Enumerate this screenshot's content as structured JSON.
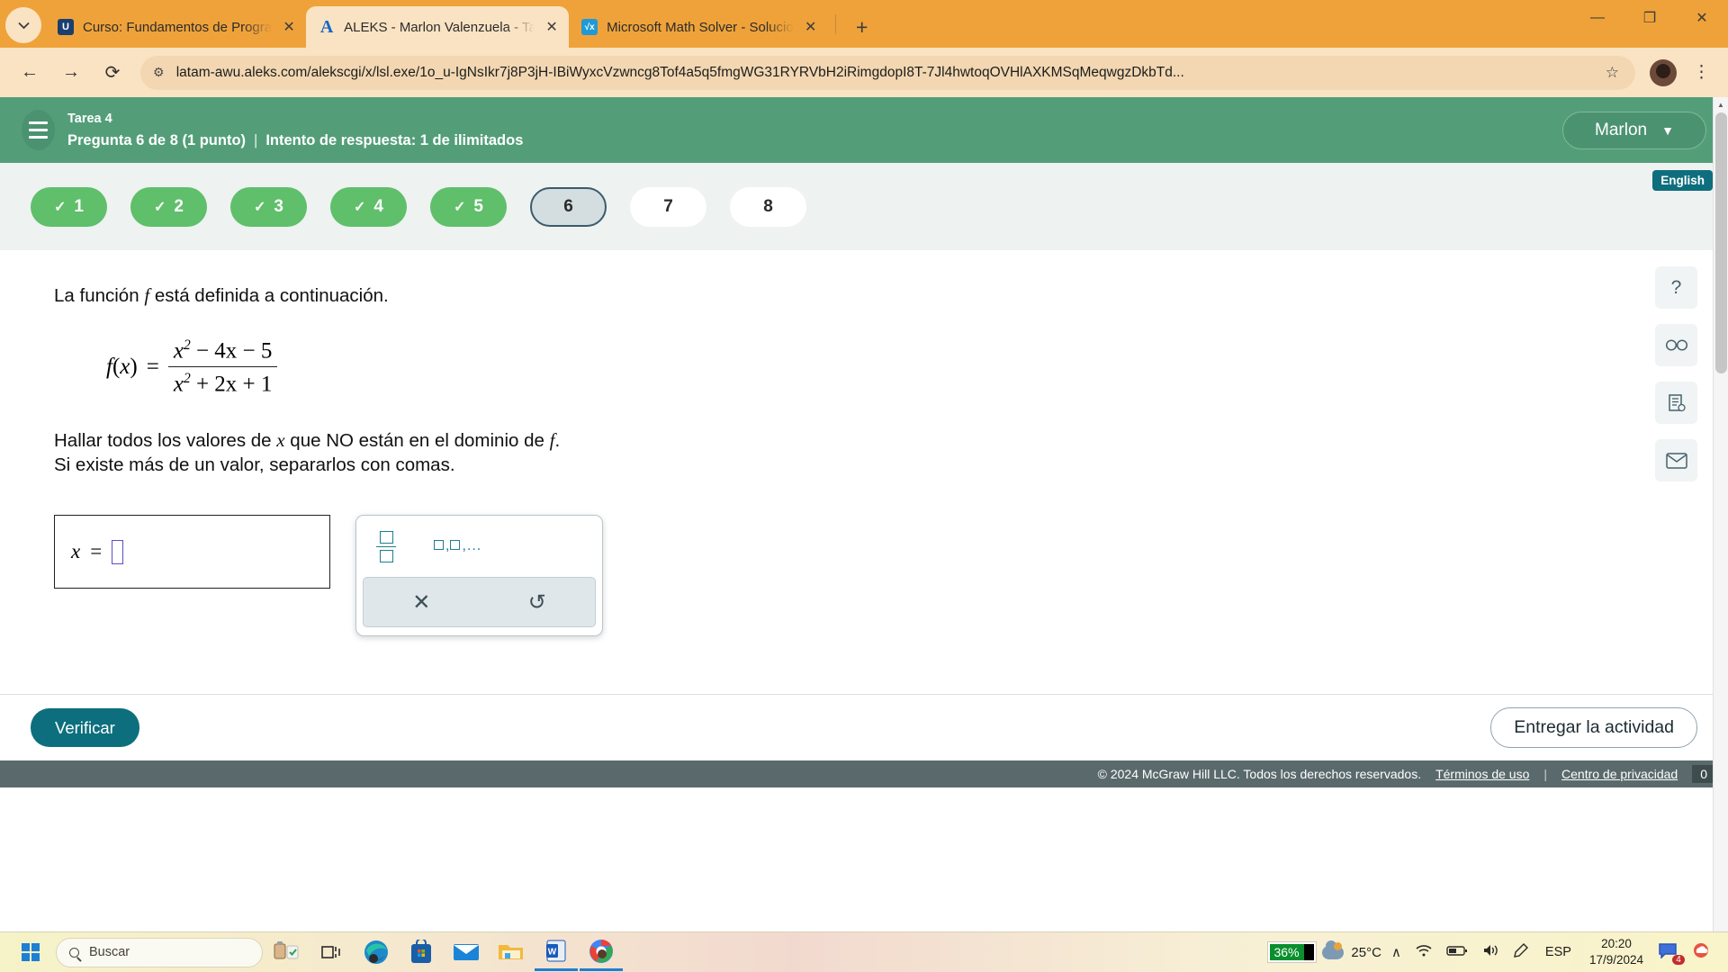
{
  "browser": {
    "tabs": [
      {
        "title": "Curso: Fundamentos de Progra",
        "icon": "university-icon",
        "active": false
      },
      {
        "title": "ALEKS - Marlon Valenzuela - Ta",
        "icon": "aleks-icon",
        "active": true
      },
      {
        "title": "Microsoft Math Solver - Solucio",
        "icon": "math-solver-icon",
        "active": false
      }
    ],
    "new_tab_label": "+",
    "tab_search_icon": "chevron-down-icon",
    "nav": {
      "back": "←",
      "forward": "→",
      "reload": "⟳"
    },
    "url": "latam-awu.aleks.com/alekscgi/x/lsl.exe/1o_u-IgNsIkr7j8P3jH-IBiWyxcVzwncg8Tof4a5q5fmgWG31RYRVbH2iRimgdopI8T-7Jl4hwtoqOVHlAXKMSqMeqwgzDkbTd...",
    "url_domain": "latam-awu.aleks.com",
    "site_info_icon": "site-settings-icon",
    "bookmark_icon": "star-icon",
    "profile_icon": "avatar",
    "menu_icon": "kebab-menu-icon",
    "window_controls": {
      "minimize": "—",
      "maximize": "❐",
      "close": "✕"
    }
  },
  "aleks": {
    "menu_icon": "hamburger-icon",
    "assignment": "Tarea 4",
    "question_status": "Pregunta 6 de 8 (1 punto)",
    "separator": "|",
    "attempt_status": "Intento de respuesta: 1 de ilimitados",
    "user_name": "Marlon",
    "user_chevron": "▼",
    "language_badge": "English",
    "questions": [
      {
        "label": "1",
        "state": "done",
        "check": "✓"
      },
      {
        "label": "2",
        "state": "done",
        "check": "✓"
      },
      {
        "label": "3",
        "state": "done",
        "check": "✓"
      },
      {
        "label": "4",
        "state": "done",
        "check": "✓"
      },
      {
        "label": "5",
        "state": "done",
        "check": "✓"
      },
      {
        "label": "6",
        "state": "current",
        "check": ""
      },
      {
        "label": "7",
        "state": "todo",
        "check": ""
      },
      {
        "label": "8",
        "state": "todo",
        "check": ""
      }
    ],
    "problem": {
      "intro_before": "La función ",
      "intro_var": "f",
      "intro_after": " está definida a continuación.",
      "formula": {
        "lhs_f": "f",
        "lhs_paren_open": "(",
        "lhs_var": "x",
        "lhs_paren_close": ")",
        "equals": "=",
        "numerator": "x² − 4x − 5",
        "num_base": "x",
        "num_exp": "2",
        "num_rest": "− 4x − 5",
        "denominator": "x² + 2x + 1",
        "den_base": "x",
        "den_exp": "2",
        "den_rest": "+ 2x + 1"
      },
      "prompt_line1_a": "Hallar todos los valores de ",
      "prompt_line1_var": "x",
      "prompt_line1_b": " que NO están en el dominio de ",
      "prompt_line1_var2": "f",
      "prompt_line1_c": ".",
      "prompt_line2": "Si existe más de un valor, separarlos con comas."
    },
    "answer": {
      "label_var": "x",
      "equals": "=",
      "value": "",
      "caret": ""
    },
    "mathpad": {
      "fraction_label": "fraction-template",
      "list_label": "□,□,...",
      "clear_icon": "✕",
      "undo_icon": "↺"
    },
    "side_tools": [
      {
        "name": "help-icon",
        "glyph": "?"
      },
      {
        "name": "glasses-icon",
        "glyph": "∞"
      },
      {
        "name": "notes-icon",
        "glyph": "☷"
      },
      {
        "name": "mail-icon",
        "glyph": "✉"
      }
    ],
    "verify_label": "Verificar",
    "submit_label": "Entregar la actividad",
    "footer": {
      "copyright": "© 2024 McGraw Hill LLC. Todos los derechos reservados.",
      "terms": "Términos de uso",
      "pipe": "|",
      "privacy": "Centro de privacidad",
      "counter": "0"
    }
  },
  "taskbar": {
    "start_label": "windows-start",
    "search_placeholder": "Buscar",
    "search_icon": "search-icon",
    "items": [
      {
        "name": "task-view-icon"
      },
      {
        "name": "edge-icon"
      },
      {
        "name": "microsoft-store-icon"
      },
      {
        "name": "mail-icon"
      },
      {
        "name": "file-explorer-icon"
      },
      {
        "name": "word-icon"
      },
      {
        "name": "chrome-icon"
      }
    ],
    "battery_percent": "36%",
    "temperature": "25°C",
    "language": "ESP",
    "time": "20:20",
    "date": "17/9/2024",
    "notification_count": "4",
    "tray": {
      "chevron": "∧",
      "wifi": "◠",
      "battery": "▭",
      "volume": "ᴘ"
    }
  },
  "colors": {
    "aleks_green": "#539e79",
    "pill_green": "#5fbf6b",
    "teal": "#0d6f7e",
    "browser_orange": "#efa23a",
    "tab_cream": "#fae3c3"
  }
}
